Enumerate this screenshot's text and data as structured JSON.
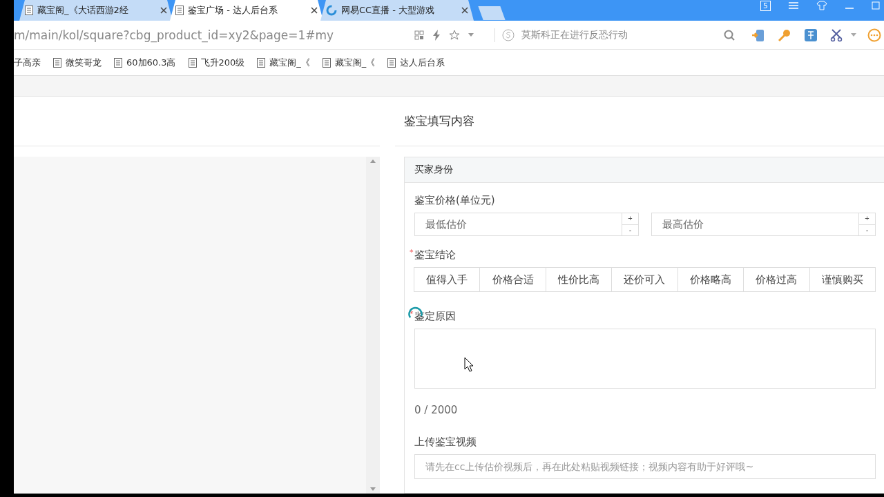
{
  "browser": {
    "tabs": [
      {
        "title": "藏宝阁_《大话西游2经",
        "selected": false,
        "kind": "doc"
      },
      {
        "title": "鉴宝广场 - 达人后台系",
        "selected": true,
        "kind": "doc"
      },
      {
        "title": "网易CC直播 - 大型游戏",
        "selected": false,
        "kind": "cc"
      }
    ],
    "address": "m/main/kol/square?cbg_product_id=xy2&page=1#my",
    "search_placeholder": "莫斯科正在进行反恐行动",
    "window_badge": "5",
    "bookmarks": [
      {
        "label": "子高亲",
        "kind": "plain"
      },
      {
        "label": "微笑哥龙",
        "kind": "doc"
      },
      {
        "label": "60加60.3高",
        "kind": "doc"
      },
      {
        "label": "飞升200级",
        "kind": "doc"
      },
      {
        "label": "藏宝阁_《",
        "kind": "doc"
      },
      {
        "label": "藏宝阁_《",
        "kind": "doc"
      },
      {
        "label": "达人后台系",
        "kind": "doc"
      }
    ]
  },
  "page": {
    "section_title": "鉴宝填写内容",
    "form": {
      "card_title": "买家身份",
      "price_label": "鉴宝价格(单位元)",
      "price_fields": [
        {
          "placeholder": "最低估价",
          "plus": "+",
          "minus": "-"
        },
        {
          "placeholder": "最高估价",
          "plus": "+",
          "minus": "-"
        }
      ],
      "conclusion_label": "鉴宝结论",
      "conclusion_mark": "*",
      "conclusions": [
        {
          "label": "值得入手",
          "selected": false
        },
        {
          "label": "价格合适",
          "selected": false
        },
        {
          "label": "性价比高",
          "selected": false
        },
        {
          "label": "还价可入",
          "selected": false
        },
        {
          "label": "价格略高",
          "selected": false
        },
        {
          "label": "价格过高",
          "selected": false
        },
        {
          "label": "谨慎购买",
          "selected": false
        }
      ],
      "reason_label": "鉴定原因",
      "reason_mark": "*",
      "reason_counter": "0 / 2000",
      "video_label": "上传鉴宝视频",
      "video_placeholder": "请先在cc上传估价视频后，再在此处粘贴视频链接；视频内容有助于好评哦~"
    }
  }
}
